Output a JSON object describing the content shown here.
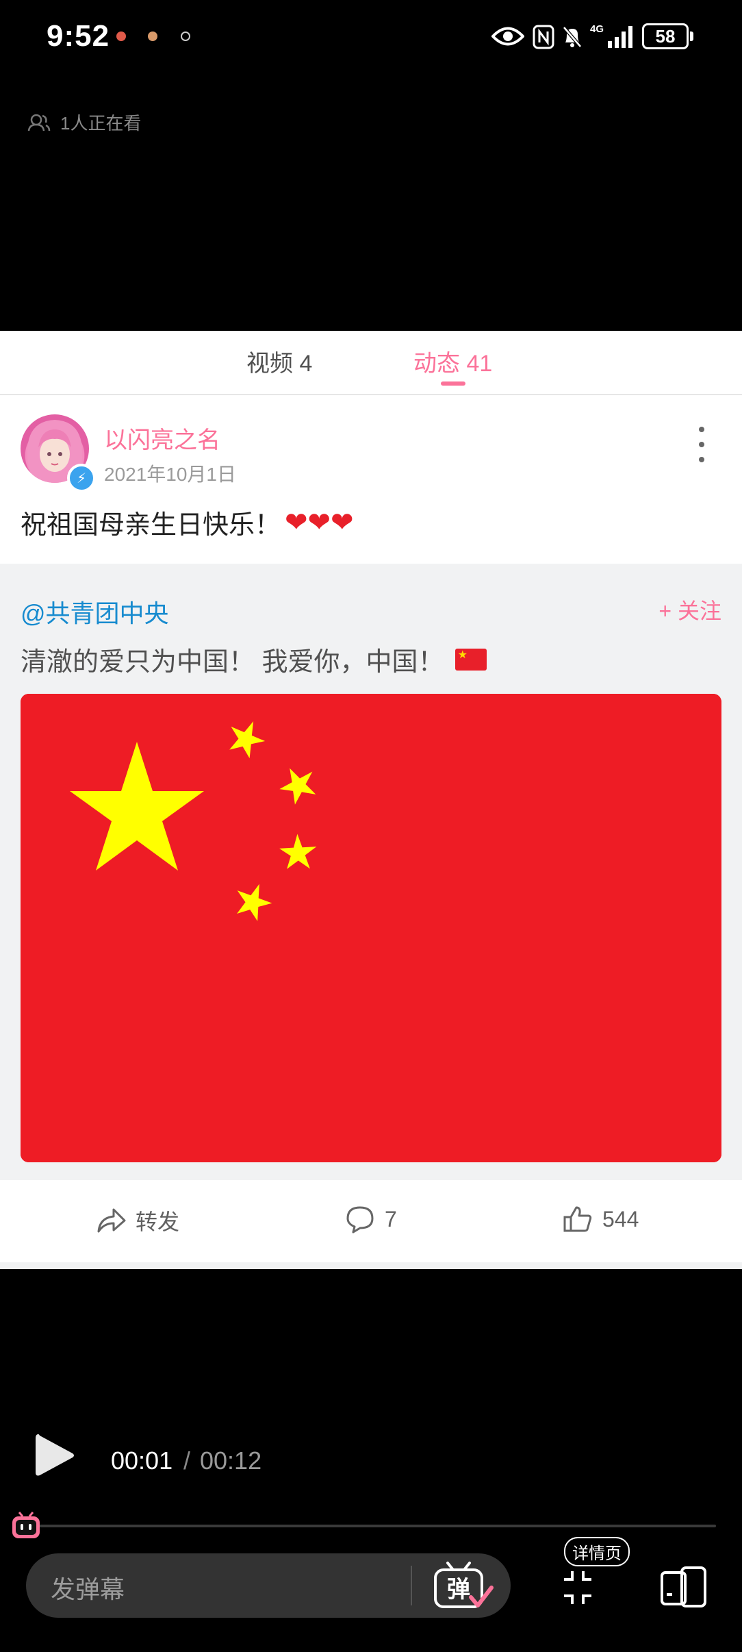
{
  "status_bar": {
    "time": "9:52",
    "network": "4G",
    "battery": "58"
  },
  "viewers": {
    "text": "1人正在看"
  },
  "tabs": [
    {
      "label": "视频 4",
      "active": false
    },
    {
      "label": "动态 41",
      "active": true
    }
  ],
  "post": {
    "author": "以闪亮之名",
    "date": "2021年10月1日",
    "text": "祝祖国母亲生日快乐！",
    "hearts": "❤❤❤"
  },
  "repost": {
    "author": "@共青团中央",
    "follow_label": "+ 关注",
    "text": "清澈的爱只为中国！ 我爱你，中国！"
  },
  "actions": {
    "share_label": "转发",
    "comment_count": "7",
    "like_count": "544"
  },
  "player": {
    "current_time": "00:01",
    "separator": "/",
    "total_time": "00:12",
    "danmaku_placeholder": "发弹幕",
    "danmaku_toggle": "弹",
    "detail_label": "详情页"
  },
  "colors": {
    "accent": "#fb7299",
    "link": "#178bcf",
    "flag_red": "#ee1c25",
    "flag_yellow": "#ffff00"
  }
}
